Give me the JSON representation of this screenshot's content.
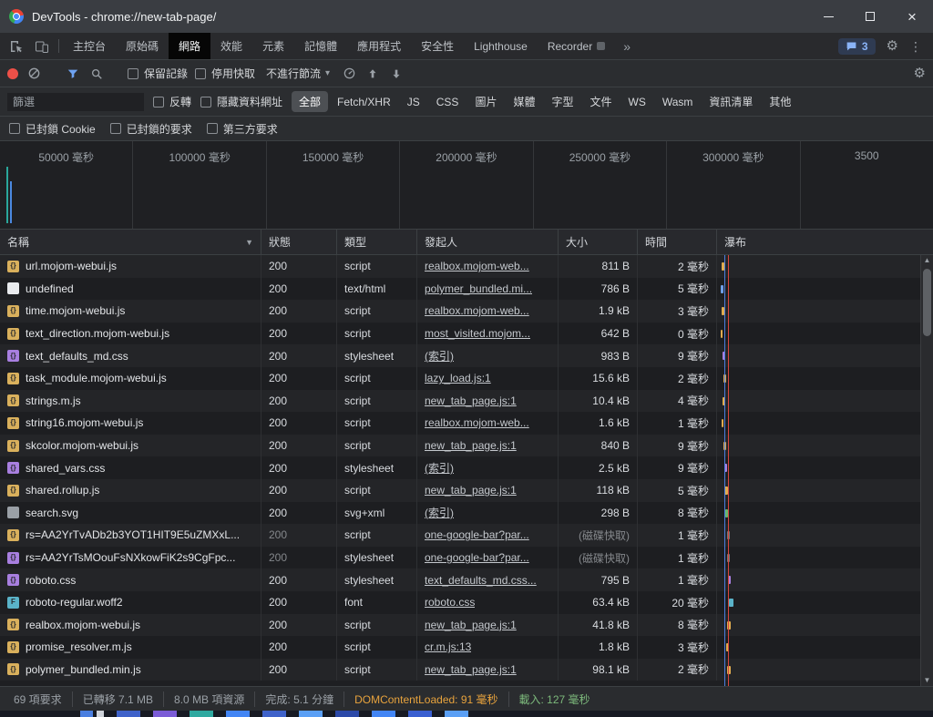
{
  "window": {
    "title": "DevTools - chrome://new-tab-page/"
  },
  "icons": {
    "gear": "⚙",
    "kebab": "⋮",
    "more": "»",
    "caret": "▾",
    "sort": "▼",
    "scroll_up": "▲",
    "scroll_down": "▼",
    "close": "×"
  },
  "tabbar": {
    "message_count": "3",
    "tabs": [
      {
        "id": "console",
        "label": "主控台",
        "selected": false
      },
      {
        "id": "sources",
        "label": "原始碼",
        "selected": false
      },
      {
        "id": "network",
        "label": "網路",
        "selected": true
      },
      {
        "id": "performance",
        "label": "效能",
        "selected": false
      },
      {
        "id": "elements",
        "label": "元素",
        "selected": false
      },
      {
        "id": "memory",
        "label": "記憶體",
        "selected": false
      },
      {
        "id": "application",
        "label": "應用程式",
        "selected": false
      },
      {
        "id": "security",
        "label": "安全性",
        "selected": false
      },
      {
        "id": "lighthouse",
        "label": "Lighthouse",
        "selected": false
      },
      {
        "id": "recorder",
        "label": "Recorder",
        "selected": false,
        "badge": true
      }
    ]
  },
  "toolbar": {
    "preserve_log": "保留記錄",
    "disable_cache": "停用快取",
    "throttling": "不進行節流"
  },
  "filterbar": {
    "filter_placeholder": "篩選",
    "invert": "反轉",
    "hide_data_urls": "隱藏資料網址",
    "chips": [
      {
        "label": "全部",
        "selected": true
      },
      {
        "label": "Fetch/XHR"
      },
      {
        "label": "JS"
      },
      {
        "label": "CSS"
      },
      {
        "label": "圖片"
      },
      {
        "label": "媒體"
      },
      {
        "label": "字型"
      },
      {
        "label": "文件"
      },
      {
        "label": "WS"
      },
      {
        "label": "Wasm"
      },
      {
        "label": "資訊清單"
      },
      {
        "label": "其他"
      }
    ],
    "blocked_cookies": "已封鎖 Cookie",
    "blocked_requests": "已封鎖的要求",
    "third_party": "第三方要求"
  },
  "overview": {
    "ticks": [
      "50000 毫秒",
      "100000 毫秒",
      "150000 毫秒",
      "200000 毫秒",
      "250000 毫秒",
      "300000 毫秒",
      "3500"
    ]
  },
  "table": {
    "columns": [
      "名稱",
      "狀態",
      "類型",
      "發起人",
      "大小",
      "時間",
      "瀑布"
    ],
    "icon_styles": {
      "script": {
        "color": "#d9b05c",
        "glyph": "{}"
      },
      "stylesheet": {
        "color": "#a87fe0",
        "glyph": "{}"
      },
      "document": {
        "color": "#e8eaed",
        "glyph": ""
      },
      "image": {
        "color": "#9aa0a6",
        "glyph": ""
      },
      "font": {
        "color": "#5ab3c9",
        "glyph": "F"
      }
    },
    "rows": [
      {
        "icon": "script",
        "name": "url.mojom-webui.js",
        "status": "200",
        "type": "script",
        "initiator": "realbox.mojom-web...",
        "size": "811 B",
        "time": "2 毫秒",
        "cached": false,
        "wf": [
          5,
          3,
          "#e0ac4f"
        ]
      },
      {
        "icon": "document",
        "name": "undefined",
        "status": "200",
        "type": "text/html",
        "initiator": "polymer_bundled.mi...",
        "size": "786 B",
        "time": "5 毫秒",
        "cached": false,
        "wf": [
          4,
          3,
          "#6f9fe8"
        ]
      },
      {
        "icon": "script",
        "name": "time.mojom-webui.js",
        "status": "200",
        "type": "script",
        "initiator": "realbox.mojom-web...",
        "size": "1.9 kB",
        "time": "3 毫秒",
        "cached": false,
        "wf": [
          5,
          3,
          "#e0ac4f"
        ]
      },
      {
        "icon": "script",
        "name": "text_direction.mojom-webui.js",
        "status": "200",
        "type": "script",
        "initiator": "most_visited.mojom...",
        "size": "642 B",
        "time": "0 毫秒",
        "cached": false,
        "wf": [
          4,
          2,
          "#e0ac4f"
        ]
      },
      {
        "icon": "stylesheet",
        "name": "text_defaults_md.css",
        "status": "200",
        "type": "stylesheet",
        "initiator": "(索引)",
        "size": "983 B",
        "time": "9 毫秒",
        "cached": false,
        "wf": [
          6,
          3,
          "#a87fe0"
        ]
      },
      {
        "icon": "script",
        "name": "task_module.mojom-webui.js",
        "status": "200",
        "type": "script",
        "initiator": "lazy_load.js:1",
        "size": "15.6 kB",
        "time": "2 毫秒",
        "cached": false,
        "wf": [
          7,
          3,
          "#e0ac4f"
        ]
      },
      {
        "icon": "script",
        "name": "strings.m.js",
        "status": "200",
        "type": "script",
        "initiator": "new_tab_page.js:1",
        "size": "10.4 kB",
        "time": "4 毫秒",
        "cached": false,
        "wf": [
          6,
          3,
          "#e0ac4f"
        ]
      },
      {
        "icon": "script",
        "name": "string16.mojom-webui.js",
        "status": "200",
        "type": "script",
        "initiator": "realbox.mojom-web...",
        "size": "1.6 kB",
        "time": "1 毫秒",
        "cached": false,
        "wf": [
          5,
          2,
          "#e0ac4f"
        ]
      },
      {
        "icon": "script",
        "name": "skcolor.mojom-webui.js",
        "status": "200",
        "type": "script",
        "initiator": "new_tab_page.js:1",
        "size": "840 B",
        "time": "9 毫秒",
        "cached": false,
        "wf": [
          7,
          3,
          "#e0ac4f"
        ]
      },
      {
        "icon": "stylesheet",
        "name": "shared_vars.css",
        "status": "200",
        "type": "stylesheet",
        "initiator": "(索引)",
        "size": "2.5 kB",
        "time": "9 毫秒",
        "cached": false,
        "wf": [
          8,
          3,
          "#a87fe0"
        ]
      },
      {
        "icon": "script",
        "name": "shared.rollup.js",
        "status": "200",
        "type": "script",
        "initiator": "new_tab_page.js:1",
        "size": "118 kB",
        "time": "5 毫秒",
        "cached": false,
        "wf": [
          8,
          4,
          "#e0ac4f"
        ]
      },
      {
        "icon": "image",
        "name": "search.svg",
        "status": "200",
        "type": "svg+xml",
        "initiator": "(索引)",
        "size": "298 B",
        "time": "8 毫秒",
        "cached": false,
        "wf": [
          9,
          3,
          "#69b56b"
        ]
      },
      {
        "icon": "script",
        "name": "rs=AA2YrTvADb2b3YOT1HIT9E5uZMXxL...",
        "status": "200",
        "type": "script",
        "initiator": "one-google-bar?par...",
        "size": "(磁碟快取)",
        "time": "1 毫秒",
        "cached": true,
        "wf": [
          11,
          3,
          "#74777b"
        ]
      },
      {
        "icon": "stylesheet",
        "name": "rs=AA2YrTsMOouFsNXkowFiK2s9CgFpc...",
        "status": "200",
        "type": "stylesheet",
        "initiator": "one-google-bar?par...",
        "size": "(磁碟快取)",
        "time": "1 毫秒",
        "cached": true,
        "wf": [
          11,
          3,
          "#74777b"
        ]
      },
      {
        "icon": "stylesheet",
        "name": "roboto.css",
        "status": "200",
        "type": "stylesheet",
        "initiator": "text_defaults_md.css...",
        "size": "795 B",
        "time": "1 毫秒",
        "cached": false,
        "wf": [
          12,
          3,
          "#a87fe0"
        ]
      },
      {
        "icon": "font",
        "name": "roboto-regular.woff2",
        "status": "200",
        "type": "font",
        "initiator": "roboto.css",
        "size": "63.4 kB",
        "time": "20 毫秒",
        "cached": false,
        "wf": [
          13,
          5,
          "#5ab3c9"
        ]
      },
      {
        "icon": "script",
        "name": "realbox.mojom-webui.js",
        "status": "200",
        "type": "script",
        "initiator": "new_tab_page.js:1",
        "size": "41.8 kB",
        "time": "8 毫秒",
        "cached": false,
        "wf": [
          11,
          4,
          "#e0ac4f"
        ]
      },
      {
        "icon": "script",
        "name": "promise_resolver.m.js",
        "status": "200",
        "type": "script",
        "initiator": "cr.m.js:13",
        "size": "1.8 kB",
        "time": "3 毫秒",
        "cached": false,
        "wf": [
          10,
          3,
          "#e0ac4f"
        ]
      },
      {
        "icon": "script",
        "name": "polymer_bundled.min.js",
        "status": "200",
        "type": "script",
        "initiator": "new_tab_page.js:1",
        "size": "98.1 kB",
        "time": "2 毫秒",
        "cached": false,
        "wf": [
          11,
          4,
          "#e0ac4f"
        ]
      }
    ]
  },
  "statusbar": {
    "items": [
      {
        "text": "69 項要求"
      },
      {
        "text": "已轉移 7.1 MB"
      },
      {
        "text": "8.0 MB 項資源"
      },
      {
        "text": "完成: 5.1 分鐘"
      },
      {
        "text": "DOMContentLoaded: 91 毫秒",
        "color": "#e8a33d"
      },
      {
        "text": "載入: 127 毫秒",
        "color": "#7cb87b"
      }
    ]
  }
}
